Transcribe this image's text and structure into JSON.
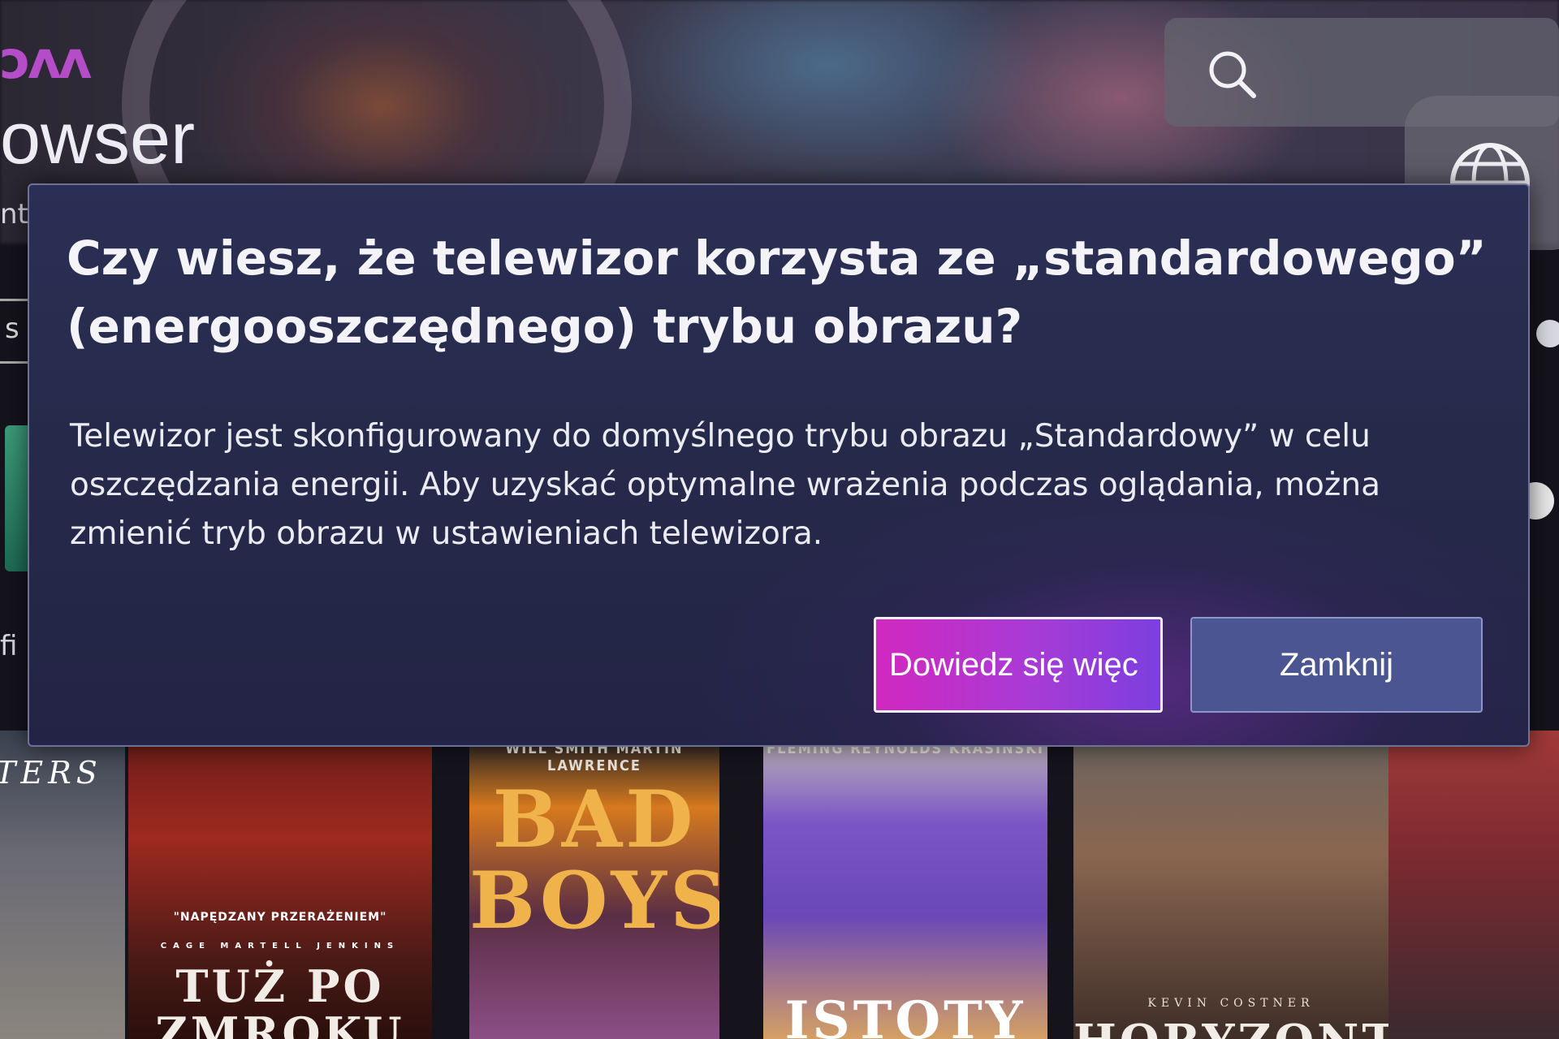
{
  "background": {
    "brand_fragment": "ᴐᴧᴧ",
    "app_title_fragment": "owser",
    "side_fragments": [
      "nt",
      "s",
      "fi"
    ],
    "icons": [
      "search-icon",
      "globe-icon"
    ],
    "posters": [
      {
        "title": "TERS"
      },
      {
        "title": "TUŻ PO ZMROKU",
        "tagline": "\"NAPĘDZANY PRZERAŻENIEM\"",
        "names": "CAGE  MARTELL  JENKINS"
      },
      {
        "title": "BAD BOYS",
        "credits": "WILL SMITH  MARTIN LAWRENCE"
      },
      {
        "title": "ISTOTY",
        "credits": "FLEMING  REYNOLDS  KRASINSKI"
      },
      {
        "title": "HORYZONT",
        "credits": "KEVIN COSTNER"
      },
      {
        "title": ""
      }
    ]
  },
  "dialog": {
    "title": "Czy wiesz, że telewizor korzysta ze „standardowego” (energooszczędnego) trybu obrazu?",
    "body": "Telewizor jest skonfigurowany do domyślnego trybu obrazu „Standardowy” w celu oszczędzania energii. Aby uzyskać optymalne wrażenia podczas oglądania, można zmienić tryb obrazu w ustawieniach telewizora.",
    "learn_more_label": "Dowiedz się więc",
    "close_label": "Zamknij",
    "accent_color": "#d128c0"
  }
}
